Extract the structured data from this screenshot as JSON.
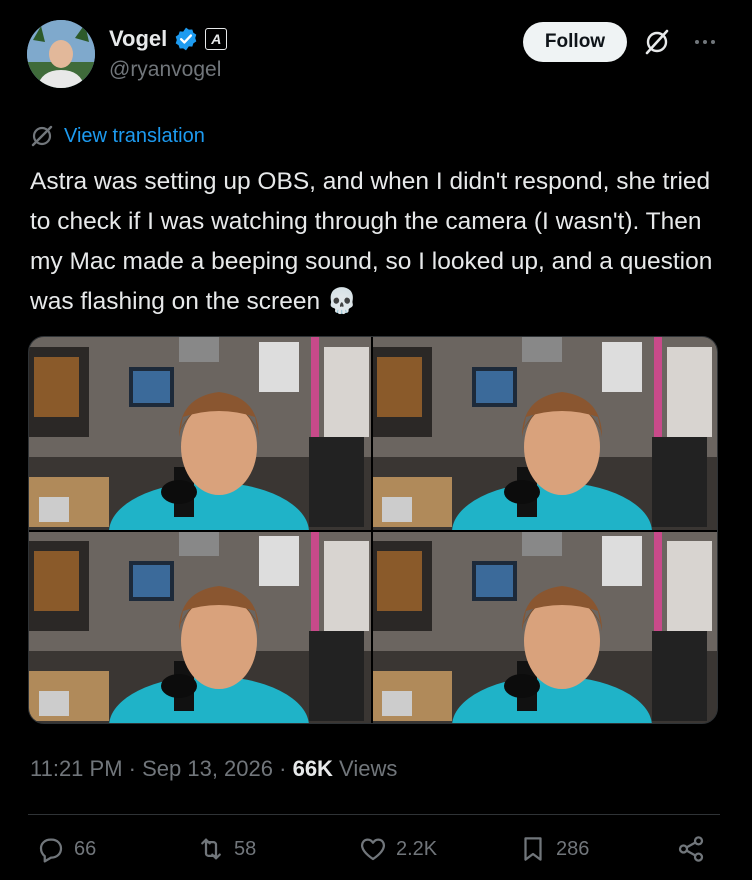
{
  "author": {
    "display_name": "Vogel",
    "handle": "@ryanvogel",
    "affiliate_badge": "A"
  },
  "header": {
    "follow_label": "Follow"
  },
  "tweet": {
    "translate_label": "View translation",
    "text": "Astra was setting up OBS, and when I didn't respond, she tried to check if I was watching through the camera (I wasn't). Then my Mac made a beeping sound, so I looked up, and a question was flashing on the screen 💀"
  },
  "meta": {
    "time": "11:21 PM",
    "separator": " · ",
    "date": "Sep 13, 2026",
    "views_count": "66K",
    "views_label": " Views"
  },
  "actions": {
    "replies": "66",
    "reposts": "58",
    "likes": "2.2K",
    "bookmarks": "286"
  },
  "colors": {
    "accent": "#1d9bf0",
    "background": "#000000",
    "muted": "#71767b"
  }
}
